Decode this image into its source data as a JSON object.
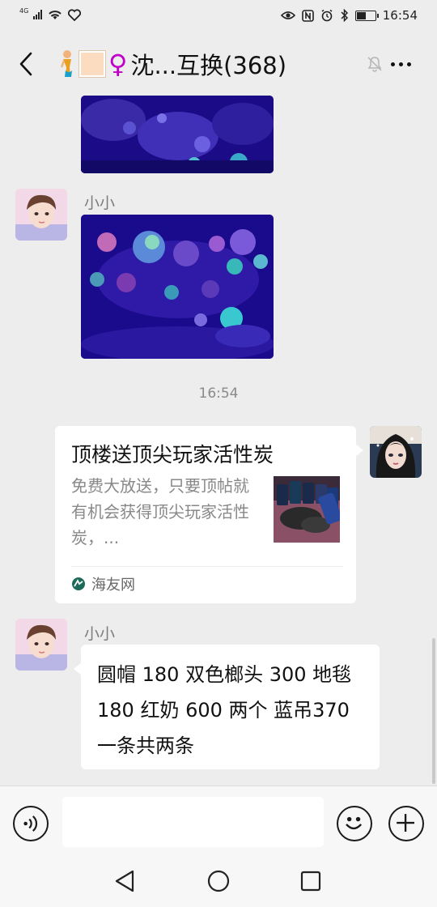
{
  "status_bar": {
    "network": "4G",
    "time": "16:54",
    "icons": [
      "signal-icon",
      "wifi-icon",
      "heart-icon",
      "eye-icon",
      "nfc-icon",
      "alarm-icon",
      "bluetooth-icon",
      "battery-icon"
    ],
    "battery_level": 0.45
  },
  "header": {
    "title": "沈...互换(368)",
    "icons": [
      "back-icon",
      "person-emoji-icon",
      "square-emoji-icon",
      "female-sign-icon",
      "mute-icon",
      "more-icon"
    ]
  },
  "messages": {
    "sender_1": "小小",
    "timestamp": "16:54",
    "link_card": {
      "title": "顶楼送顶尖玩家活性炭",
      "description": "免费大放送，只要顶帖就有机会获得顶尖玩家活性炭，...",
      "source": "海友网"
    },
    "sender_2": "小小",
    "text_message": "圆帽 180 双色榔头 300 地毯 180 红奶 600 两个 蓝吊370 一条共两条"
  },
  "input_bar": {
    "placeholder": "",
    "icons": [
      "voice-icon",
      "emoji-icon",
      "plus-icon"
    ]
  },
  "nav_bar": {
    "icons": [
      "back-triangle-icon",
      "home-circle-icon",
      "recents-square-icon"
    ]
  },
  "colors": {
    "background": "#ededed",
    "bubble": "#ffffff",
    "female_sign": "#c000c8",
    "muted_text": "#888888"
  }
}
